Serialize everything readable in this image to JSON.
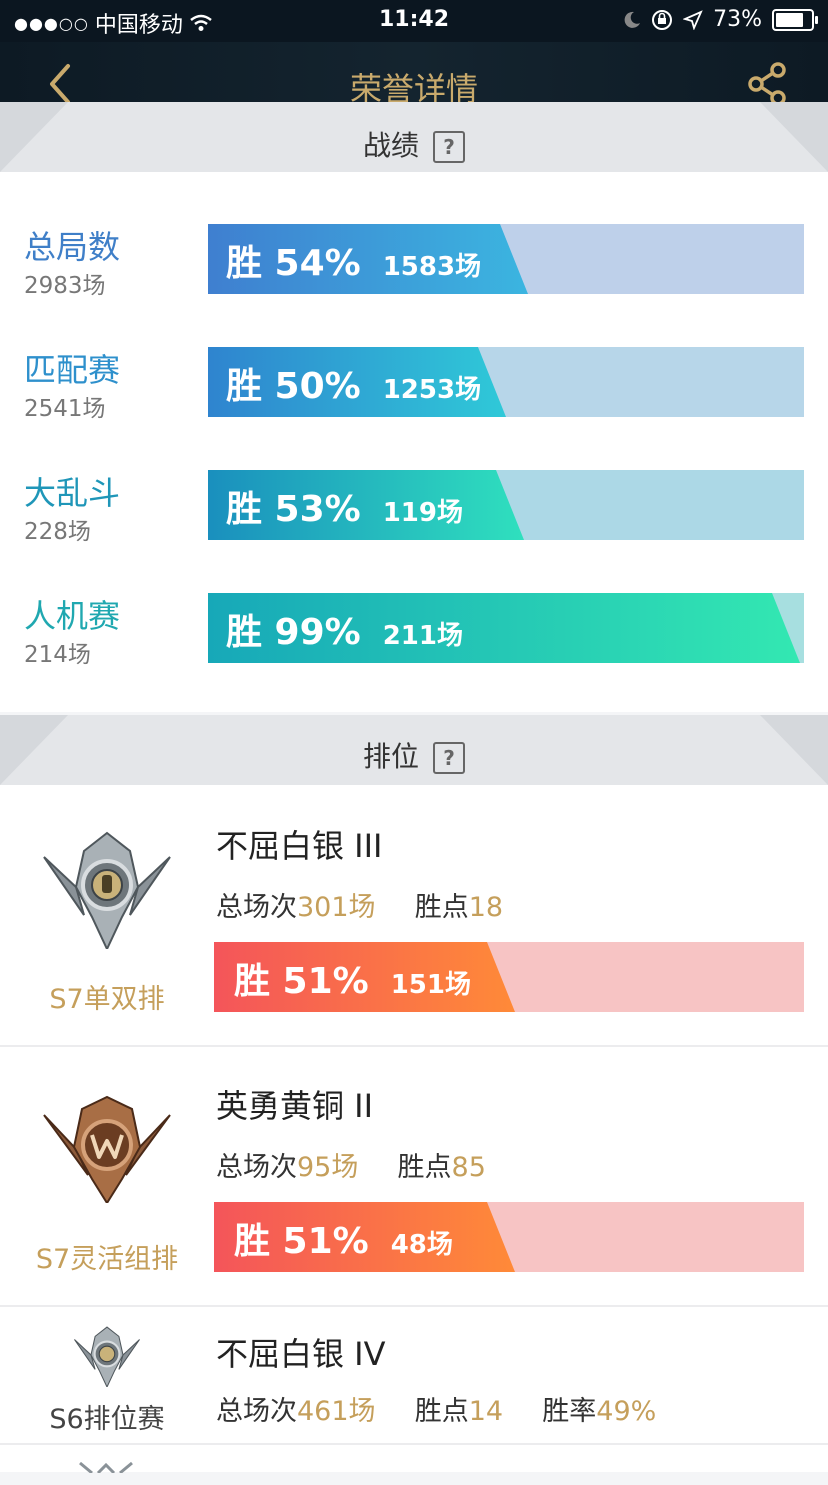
{
  "status_bar": {
    "signal": "●●●○○",
    "carrier": "中国移动",
    "time": "11:42",
    "battery_pct": "73%"
  },
  "nav": {
    "title": "荣誉详情"
  },
  "record_section": {
    "title": "战绩"
  },
  "stats": [
    {
      "name": "总局数",
      "total": "2983场",
      "win_label": "胜 54%",
      "count": "1583场",
      "win_rate": 0.54,
      "name_color": "#3f7fc8"
    },
    {
      "name": "匹配赛",
      "total": "2541场",
      "win_label": "胜 50%",
      "count": "1253场",
      "win_rate": 0.5,
      "name_color": "#2e90cc"
    },
    {
      "name": "大乱斗",
      "total": "228场",
      "win_label": "胜 53%",
      "count": "119场",
      "win_rate": 0.53,
      "name_color": "#1f96b8"
    },
    {
      "name": "人机赛",
      "total": "214场",
      "win_label": "胜 99%",
      "count": "211场",
      "win_rate": 0.99,
      "name_color": "#20a8b0"
    }
  ],
  "rank_section": {
    "title": "排位"
  },
  "ranks": [
    {
      "season": "S7单双排",
      "tier": "不屈白银 III",
      "total_label": "总场次",
      "total": "301场",
      "points_label": "胜点",
      "points": "18",
      "win_label": "胜 51%",
      "count": "151场",
      "win_rate": 0.51
    },
    {
      "season": "S7灵活组排",
      "tier": "英勇黄铜 II",
      "total_label": "总场次",
      "total": "95场",
      "points_label": "胜点",
      "points": "85",
      "win_label": "胜 51%",
      "count": "48场",
      "win_rate": 0.51
    },
    {
      "season": "S6排位赛",
      "tier": "不屈白银 IV",
      "total_label": "总场次",
      "total": "461场",
      "points_label": "胜点",
      "points": "14",
      "rate_label": "胜率",
      "rate": "49%"
    }
  ],
  "colors": {
    "gold": "#c59f5b",
    "nav_title": "#c9aa6c"
  }
}
